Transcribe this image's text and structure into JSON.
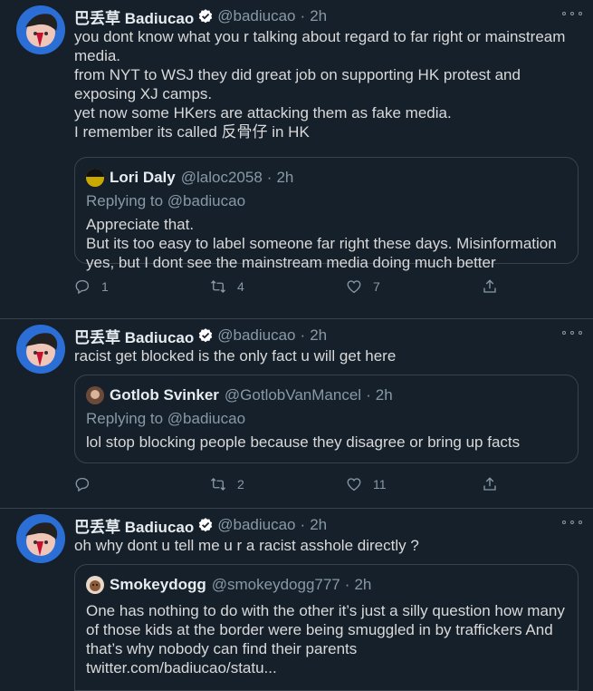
{
  "colors": {
    "background": "#15202b",
    "border": "#38444d",
    "muted": "#8899a6",
    "verified": "#ffffff"
  },
  "tweets": [
    {
      "name": "巴丢草 Badiucao",
      "handle": "@badiucao",
      "time": "2h",
      "text": "you dont know what you r talking about regard to far right or mainstream media.\nfrom NYT to WSJ they did great job on supporting HK protest and exposing XJ camps.\nyet now some HKers are attacking them as fake media.\nI remember its called 反骨仔 in HK",
      "quote": {
        "name": "Lori Daly",
        "handle": "@laloc2058",
        "time": "2h",
        "replying": "Replying to @badiucao",
        "text": "Appreciate that.\nBut its too easy to label someone far right these days. Misinformation yes, but I dont see the mainstream media doing much better"
      },
      "replies": "1",
      "retweets": "4",
      "likes": "7"
    },
    {
      "name": "巴丢草 Badiucao",
      "handle": "@badiucao",
      "time": "2h",
      "text": "racist get blocked is the only fact u will get here",
      "quote": {
        "name": "Gotlob Svinker",
        "handle": "@GotlobVanMancel",
        "time": "2h",
        "replying": "Replying to @badiucao",
        "text": "lol stop blocking people because they disagree or bring up facts"
      },
      "replies": "",
      "retweets": "2",
      "likes": "11"
    },
    {
      "name": "巴丢草 Badiucao",
      "handle": "@badiucao",
      "time": "2h",
      "text": "oh why dont u tell me u r a racist asshole directly ?",
      "quote": {
        "name": "Smokeydogg",
        "handle": "@smokeydogg777",
        "time": "2h",
        "text": "One has nothing to do with the other it’s just a silly question how many of those kids at the border were being smuggled in by traffickers And that’s why nobody can find their parents\ntwitter.com/badiucao/statu..."
      }
    }
  ]
}
